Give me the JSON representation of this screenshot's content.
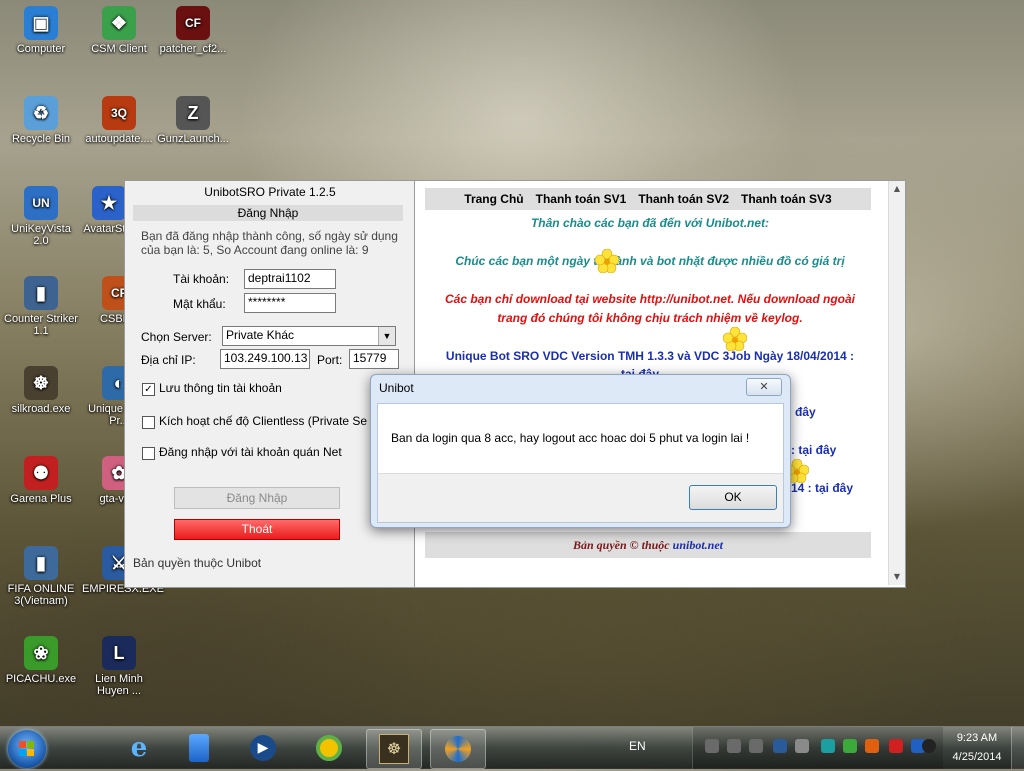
{
  "desktop_icons": [
    {
      "label": "Computer",
      "icon": "computer-icon",
      "color": "#2a7fd4",
      "glyph": "▣"
    },
    {
      "label": "CSM Client",
      "icon": "csm-client-icon",
      "color": "#3aa04a",
      "glyph": "❖"
    },
    {
      "label": "patcher_cf2...",
      "icon": "crossfire-patcher-icon",
      "color": "#6a1010",
      "glyph": "CF"
    },
    {
      "label": "Recycle Bin",
      "icon": "recycle-bin-icon",
      "color": "#5a9fd8",
      "glyph": "♻"
    },
    {
      "label": "autoupdate....",
      "icon": "autoupdate-icon",
      "color": "#b83a10",
      "glyph": "3Q"
    },
    {
      "label": "GunzLaunch...",
      "icon": "gunz-launcher-icon",
      "color": "#555555",
      "glyph": "Z"
    },
    {
      "label": "UniKeyVista 2.0",
      "icon": "unikey-icon",
      "color": "#2d6fc4",
      "glyph": "UN"
    },
    {
      "label": "AvatarSt...",
      "icon": "avatar-star-icon",
      "color": "#2a62c9",
      "glyph": "★"
    },
    {
      "label": "Counter Striker 1.1",
      "icon": "counter-strike-icon",
      "color": "#3f6390",
      "glyph": "▮"
    },
    {
      "label": "CSBL...",
      "icon": "csbl-icon",
      "color": "#c0501a",
      "glyph": "CF"
    },
    {
      "label": "silkroad.exe",
      "icon": "silkroad-icon",
      "color": "#4a4030",
      "glyph": "☸"
    },
    {
      "label": "Unique SRO Pr...",
      "icon": "unique-sro-icon",
      "color": "#2e6aa8",
      "glyph": "◐"
    },
    {
      "label": "Garena Plus",
      "icon": "garena-plus-icon",
      "color": "#c22020",
      "glyph": "⚉"
    },
    {
      "label": "gta-vc...",
      "icon": "gta-vc-icon",
      "color": "#d06080",
      "glyph": "✿"
    },
    {
      "label": "FIFA ONLINE 3(Vietnam)",
      "icon": "fifa-online-icon",
      "color": "#3d6a9a",
      "glyph": "▮"
    },
    {
      "label": "EMPIRESX.EXE",
      "icon": "empiresx-icon",
      "color": "#2a5aa0",
      "glyph": "⚔"
    },
    {
      "label": "PICACHU.exe",
      "icon": "picachu-icon",
      "color": "#3a9a2a",
      "glyph": "❀"
    },
    {
      "label": "Lien Minh Huyen ...",
      "icon": "league-icon",
      "color": "#1a2a5a",
      "glyph": "L"
    }
  ],
  "unibot": {
    "title": "UnibotSRO Private 1.2.5",
    "section": "Đăng Nhập",
    "status_line1": "Bạn đã đăng nhập thành công, số ngày sử dụng",
    "status_line2": "của bạn là: 5, So Account đang online là: 9",
    "account_label": "Tài khoản:",
    "account_value": "deptrai1102",
    "password_label": "Mật khẩu:",
    "password_value": "********",
    "server_label": "Chọn Server:",
    "server_value": "Private Khác",
    "ip_label": "Địa chỉ IP:",
    "ip_value": "103.249.100.13",
    "port_label": "Port:",
    "port_value": "15779",
    "save_label": "Lưu thông tin tài khoản",
    "save_checked": true,
    "clientless_label": "Kích hoạt chế độ Clientless (Private Se",
    "clientless_checked": false,
    "net_label": "Đăng nhập với tài khoản quán Net",
    "net_checked": false,
    "login_button": "Đăng Nhập",
    "exit_button": "Thoát",
    "copyright": "Bản quyền thuộc Unibot"
  },
  "web": {
    "nav": [
      "Trang Chủ",
      "Thanh toán SV1",
      "Thanh toán SV2",
      "Thanh toán SV3"
    ],
    "welcome": "Thân chào các bạn đã đến với Unibot.net:",
    "wish": "Chúc các bạn một ngày tốt lành và bot nhặt được nhiều đồ có giá trị",
    "warning1": "Các bạn chỉ download tại website http://unibot.net. Nếu download ngoài",
    "warning2": "trang đó chúng tôi không chịu trách nhiệm về keylog.",
    "version_line": "Unique Bot SRO VDC Version TMH 1.3.3 và VDC 3Job Ngày 18/04/2014 :",
    "version_link": "tại đây",
    "partial1": "đây",
    "partial2": ": tại đây",
    "partial3": "14 : tại đây",
    "footer_prefix": "Bản quyền © thuộc ",
    "footer_link": "unibot.net"
  },
  "dialog": {
    "title": "Unibot",
    "message": "Ban da login qua 8 acc, hay logout acc hoac doi 5 phut va login lai !",
    "ok_button": "OK"
  },
  "taskbar": {
    "language": "EN",
    "time": "9:23 AM",
    "date": "4/25/2014"
  }
}
